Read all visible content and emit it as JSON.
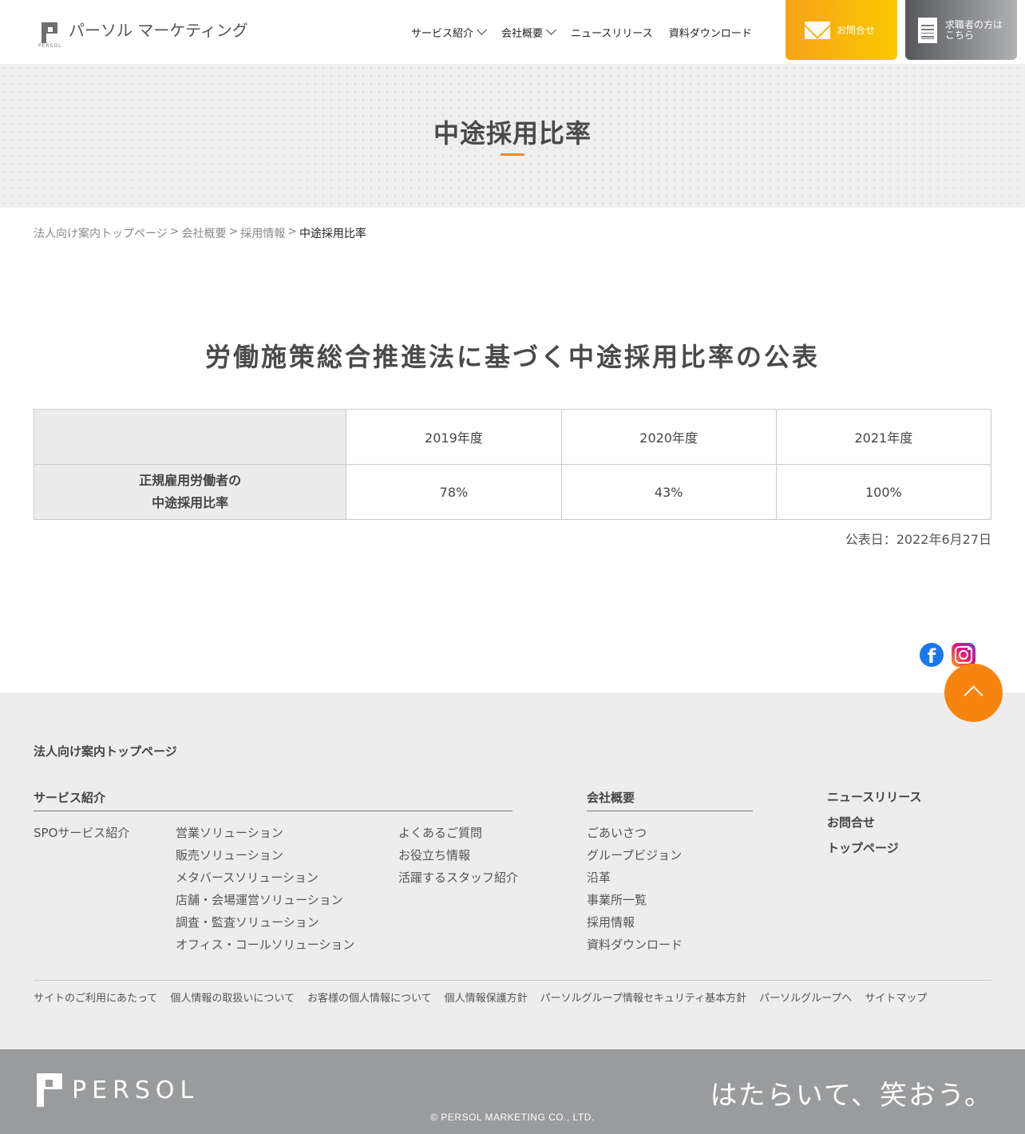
{
  "header": {
    "logo_text": "パーソル マーケティング",
    "logo_sub": "PERSOL",
    "nav": [
      {
        "label": "サービス紹介",
        "has_dropdown": true
      },
      {
        "label": "会社概要",
        "has_dropdown": true
      },
      {
        "label": "ニュースリリース",
        "has_dropdown": false
      },
      {
        "label": "資料ダウンロード",
        "has_dropdown": false
      }
    ],
    "contact_label": "お問合せ",
    "job_label_1": "求職者の方は",
    "job_label_2": "こちら"
  },
  "page": {
    "title": "中途採用比率",
    "breadcrumb": [
      "法人向け案内トップページ",
      "会社概要",
      "採用情報",
      "中途採用比率"
    ],
    "heading": "労働施策総合推進法に基づく中途採用比率の公表",
    "table": {
      "years": [
        "2019年度",
        "2020年度",
        "2021年度"
      ],
      "row_label_1": "正規雇用労働者の",
      "row_label_2": "中途採用比率",
      "values": [
        "78%",
        "43%",
        "100%"
      ]
    },
    "published": "公表日：2022年6月27日"
  },
  "footer": {
    "top_link": "法人向け案内トップページ",
    "service_head": "サービス紹介",
    "service_col1": [
      "SPOサービス紹介"
    ],
    "service_col2": [
      "営業ソリューション",
      "販売ソリューション",
      "メタバースソリューション",
      "店舗・会場運営ソリューション",
      "調査・監査ソリューション",
      "オフィス・コールソリューション"
    ],
    "service_col3": [
      "よくあるご質問",
      "お役立ち情報",
      "活躍するスタッフ紹介"
    ],
    "company_head": "会社概要",
    "company_links": [
      "ごあいさつ",
      "グループビジョン",
      "沿革",
      "事業所一覧",
      "採用情報",
      "資料ダウンロード"
    ],
    "right_links": [
      "ニュースリリース",
      "お問合せ",
      "トップページ"
    ],
    "legal": [
      "サイトのご利用にあたって",
      "個人情報の取扱いについて",
      "お客様の個人情報について",
      "個人情報保護方針",
      "パーソルグループ情報セキュリティ基本方針",
      "パーソルグループへ",
      "サイトマップ"
    ],
    "brand": "PERSOL",
    "slogan": "はたらいて、笑おう。",
    "copyright": "© PERSOL MARKETING CO., LTD."
  },
  "icons": [
    "mail-icon",
    "document-icon",
    "chevron-down-icon",
    "facebook-icon",
    "instagram-icon",
    "arrow-up-icon"
  ],
  "colors": {
    "accent": "#f7840f",
    "contact_gradient": [
      "#f7a21b",
      "#fbc800"
    ],
    "job_gradient": [
      "#55575a",
      "#b1b2b4"
    ],
    "footer_bg": "#ededed",
    "copyright_bg": "#9a9b9d"
  }
}
